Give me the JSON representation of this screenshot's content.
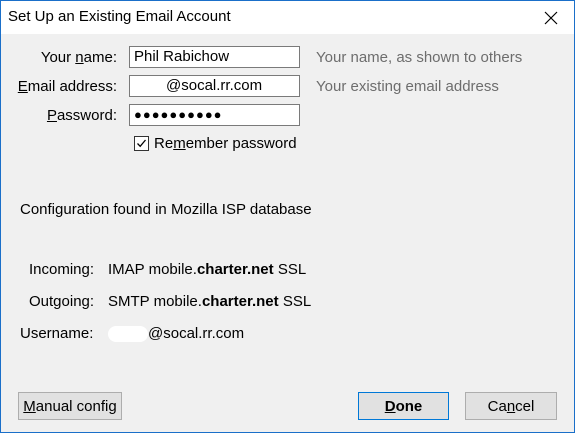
{
  "window": {
    "title": "Set Up an Existing Email Account"
  },
  "form": {
    "name_label_pre": "Your ",
    "name_label_key": "n",
    "name_label_post": "ame:",
    "name_value": "Phil Rabichow",
    "name_hint": "Your name, as shown to others",
    "email_label_key": "E",
    "email_label_post": "mail address:",
    "email_value_suffix": "@socal.rr.com",
    "email_hint": "Your existing email address",
    "password_label_key": "P",
    "password_label_post": "assword:",
    "password_value": "●●●●●●●●●●",
    "remember_pre": "Re",
    "remember_key": "m",
    "remember_post": "ember password",
    "remember_checked": true
  },
  "config": {
    "found_text": "Configuration found in Mozilla ISP database",
    "incoming_label": "Incoming:",
    "incoming_protocol": "IMAP",
    "incoming_host_prefix": "mobile.",
    "incoming_host_domain": "charter.net",
    "incoming_security": "SSL",
    "outgoing_label": "Outgoing:",
    "outgoing_protocol": "SMTP",
    "outgoing_host_prefix": "mobile.",
    "outgoing_host_domain": "charter.net",
    "outgoing_security": "SSL",
    "username_label": "Username:",
    "username_suffix": "@socal.rr.com"
  },
  "buttons": {
    "manual_key": "M",
    "manual_post": "anual config",
    "done_key": "D",
    "done_post": "one",
    "cancel_pre": "Ca",
    "cancel_key": "n",
    "cancel_post": "cel"
  }
}
